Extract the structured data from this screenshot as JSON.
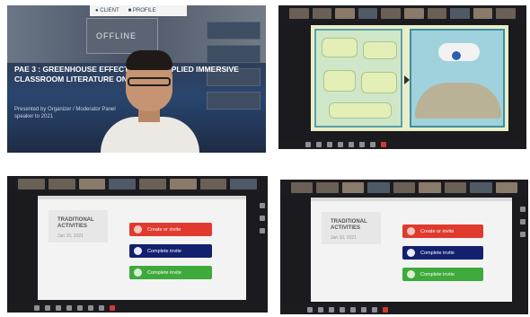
{
  "panel1": {
    "badges": [
      "● CLIENT",
      "■ PROFILE"
    ],
    "stage_screen": "OFFLINE",
    "slide_title": "PAE 3 : GREENHOUSE EFFECT OF THE APPLIED IMMERSIVE CLASSROOM LITERATURE ONLINE",
    "slide_subtitle": "Presented by Organizer / Moderator Panel speaker to 2021"
  },
  "panel3": {
    "slide_title": "TRADITIONAL ACTIVITIES",
    "slide_date": "Jan 10, 2021",
    "buttons": [
      {
        "label": "Create or invite",
        "color": "#e03a2e"
      },
      {
        "label": "Complete invite",
        "color": "#12206e"
      },
      {
        "label": "Complete invite",
        "color": "#3eaa3c"
      }
    ]
  },
  "panel4": {
    "slide_title": "TRADITIONAL ACTIVITIES",
    "slide_date": "Jan 10, 2021",
    "buttons": [
      {
        "label": "Create or invite",
        "color": "#e03a2e"
      },
      {
        "label": "Complete invite",
        "color": "#12206e"
      },
      {
        "label": "Complete invite",
        "color": "#3eaa3c"
      }
    ]
  },
  "icons": {
    "meeting_controls": [
      "mute-icon",
      "video-icon",
      "participants-icon",
      "chat-icon",
      "share-screen-icon",
      "record-icon",
      "reactions-icon",
      "leave-icon"
    ]
  }
}
